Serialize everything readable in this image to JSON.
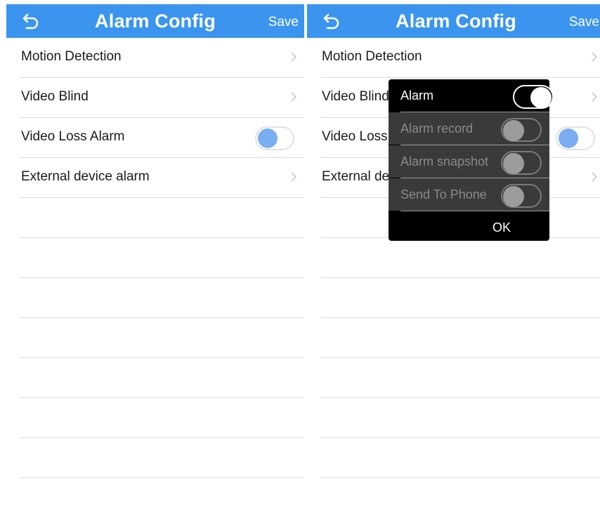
{
  "left": {
    "header": {
      "title": "Alarm Config",
      "save_label": "Save",
      "back_icon": "back-arrow-icon"
    },
    "rows": [
      {
        "label": "Motion Detection",
        "control": "chevron"
      },
      {
        "label": "Video Blind",
        "control": "chevron"
      },
      {
        "label": "Video Loss Alarm",
        "control": "toggle",
        "toggle_color": "#79aef0"
      },
      {
        "label": "External device alarm",
        "control": "chevron"
      }
    ]
  },
  "right": {
    "header": {
      "title": "Alarm Config",
      "save_label": "Save",
      "back_icon": "back-arrow-icon"
    },
    "rows": [
      {
        "label": "Motion Detection",
        "control": "chevron"
      },
      {
        "label": "Video Blind",
        "control": "chevron"
      },
      {
        "label": "Video Loss Alarm",
        "control": "toggle",
        "toggle_color": "#79aef0"
      },
      {
        "label": "External device alarm",
        "control": "chevron"
      }
    ],
    "dialog": {
      "items": [
        {
          "label": "Alarm",
          "state": "on",
          "enabled": true
        },
        {
          "label": "Alarm record",
          "state": "off",
          "enabled": false
        },
        {
          "label": "Alarm snapshot",
          "state": "off",
          "enabled": false
        },
        {
          "label": "Send To Phone",
          "state": "off",
          "enabled": false
        }
      ],
      "ok_label": "OK"
    }
  },
  "colors": {
    "header_bg": "#3b95ee",
    "divider": "#dcdcdc",
    "dialog_bg": "#000000"
  }
}
